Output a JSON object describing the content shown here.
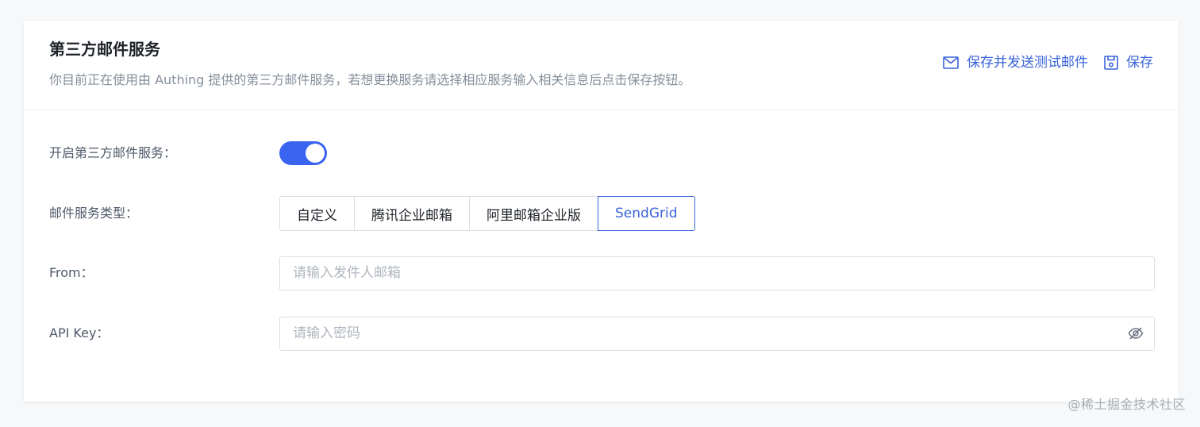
{
  "header": {
    "title": "第三方邮件服务",
    "description": "你目前正在使用由 Authing 提供的第三方邮件服务，若想更换服务请选择相应服务输入相关信息后点击保存按钮。",
    "actions": {
      "send_test_label": "保存并发送测试邮件",
      "save_label": "保存"
    }
  },
  "form": {
    "enable": {
      "label": "开启第三方邮件服务：",
      "value": true
    },
    "service_type": {
      "label": "邮件服务类型：",
      "options": [
        "自定义",
        "腾讯企业邮箱",
        "阿里邮箱企业版",
        "SendGrid"
      ],
      "selected": "SendGrid"
    },
    "from": {
      "label": "From：",
      "value": "",
      "placeholder": "请输入发件人邮箱"
    },
    "api_key": {
      "label": "API Key：",
      "value": "",
      "placeholder": "请输入密码"
    }
  },
  "watermark": "@稀土掘金技术社区",
  "colors": {
    "accent": "#3a64d8",
    "switch_on": "#3a64f0"
  }
}
